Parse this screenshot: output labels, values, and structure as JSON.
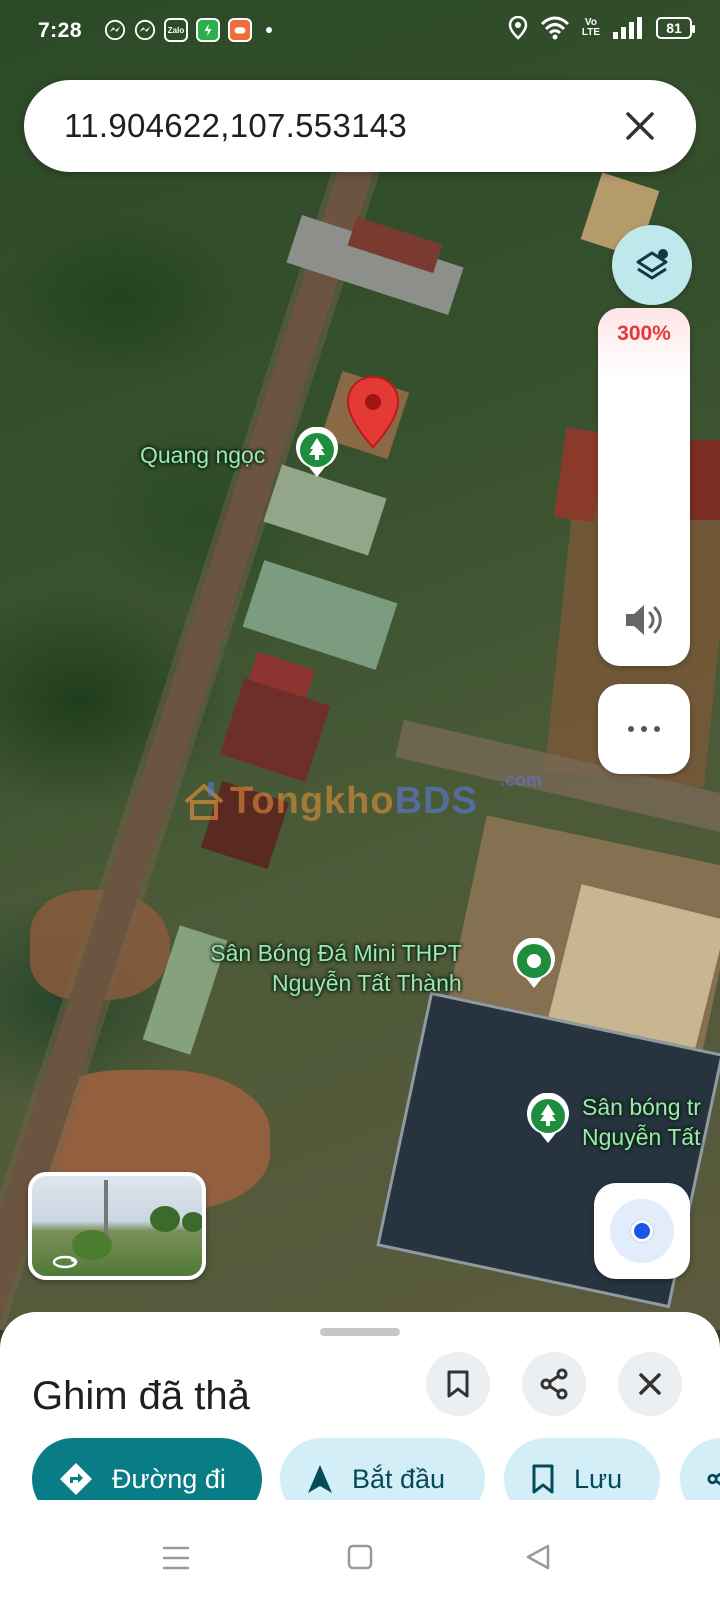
{
  "status_bar": {
    "time": "7:28",
    "notification_apps": [
      "messenger-icon",
      "messenger-icon",
      "zalo-icon",
      "vpn-shield-icon",
      "game-app-icon"
    ],
    "zalo_label": "Zalo",
    "network_label_top": "Vo",
    "network_label_bottom": "LTE",
    "battery": "81"
  },
  "search": {
    "query": "11.904622,107.553143"
  },
  "map": {
    "zoom_level": "300%",
    "watermark_left": "Tongkho",
    "watermark_right": "BDS",
    "watermark_suffix": ".com",
    "places": [
      {
        "label": "Quang ngọc",
        "type": "park"
      },
      {
        "label_line1": "Sân Bóng Đá Mini THPT",
        "label_line2": "Nguyễn Tất Thành",
        "type": "sports"
      },
      {
        "label_line1": "Sân bóng tr",
        "label_line2": "Nguyễn Tất",
        "type": "park"
      }
    ],
    "colors": {
      "pin_red": "#e53935",
      "poi_green": "#1e8e3e",
      "accent_teal": "#087d86"
    }
  },
  "place_sheet": {
    "title": "Ghim đã thả",
    "actions": {
      "directions": "Đường đi",
      "start": "Bắt đầu",
      "save": "Lưu"
    }
  }
}
